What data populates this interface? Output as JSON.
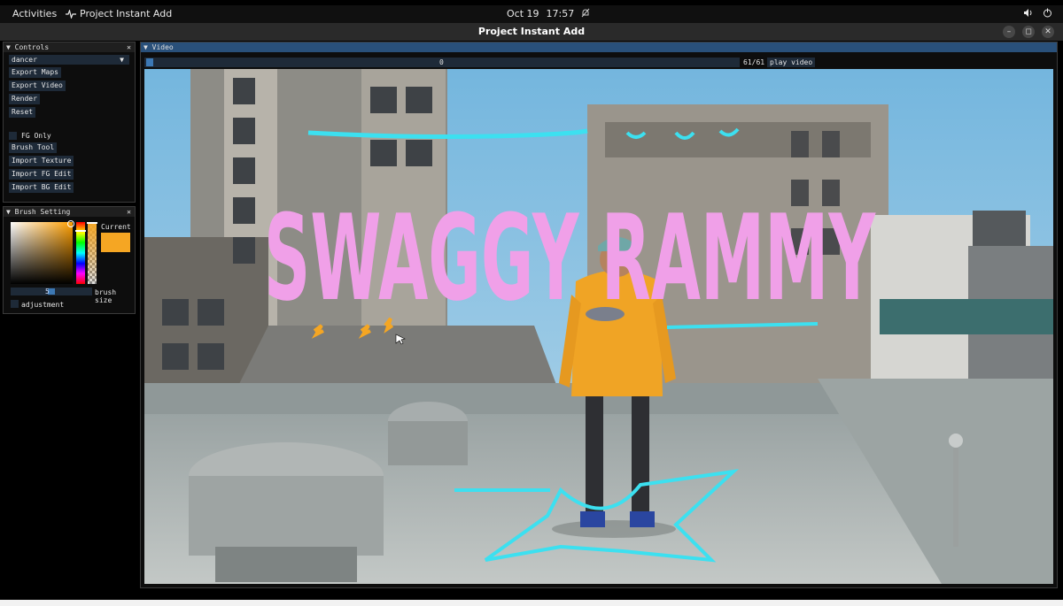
{
  "topbar": {
    "activities": "Activities",
    "app_name": "Project Instant Add",
    "date": "Oct 19",
    "time": "17:57"
  },
  "window": {
    "title": "Project Instant Add"
  },
  "controls": {
    "title": "Controls",
    "dropdown_value": "dancer",
    "buttons": [
      "Export Maps",
      "Export Video",
      "Render",
      "Reset"
    ],
    "fg_only": "FG Only",
    "buttons2": [
      "Brush Tool",
      "Import Texture",
      "Import FG Edit",
      "Import BG Edit"
    ]
  },
  "brush": {
    "title": "Brush Setting",
    "current_label": "Current",
    "current_color": "#f5a623",
    "size_value": "5",
    "size_label": "brush size",
    "adjustment": "adjustment"
  },
  "video": {
    "title": "Video",
    "slider_value": "0",
    "frames": "61/61",
    "play_label": "play video",
    "overlay_text": "SWAGGY RAMMY"
  },
  "colors": {
    "accent": "#29507a",
    "overlay_pink": "#f0a0e8",
    "stroke_cyan": "#3ce0f0",
    "stroke_orange": "#f5a623"
  }
}
